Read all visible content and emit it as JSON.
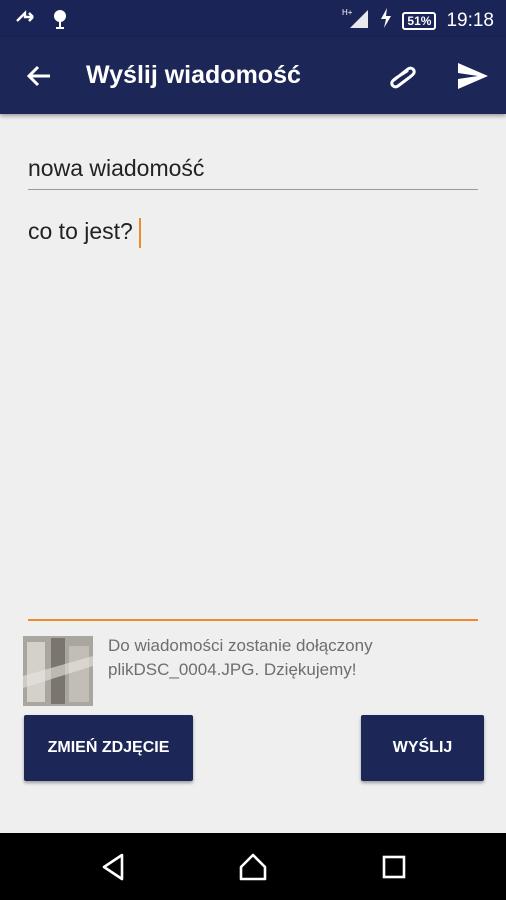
{
  "status_bar": {
    "time": "19:18",
    "battery": "51%",
    "network": "H+"
  },
  "app_bar": {
    "title": "Wyślij wiadomość"
  },
  "form": {
    "subject": "nowa wiadomość",
    "message": "co to jest?"
  },
  "attachment": {
    "note": "Do wiadomości zostanie dołączony plikDSC_0004.JPG. Dziękujemy!"
  },
  "buttons": {
    "change_photo": "ZMIEŃ ZDJĘCIE",
    "send": "WYŚLIJ"
  },
  "colors": {
    "primary": "#1c2758",
    "accent": "#ee8a2a",
    "background": "#efefef"
  },
  "icons": {
    "back": "arrow-back-icon",
    "attach": "paperclip-icon",
    "send": "send-icon",
    "nav_back": "triangle-back-icon",
    "nav_home": "home-icon",
    "nav_recents": "square-recents-icon"
  }
}
